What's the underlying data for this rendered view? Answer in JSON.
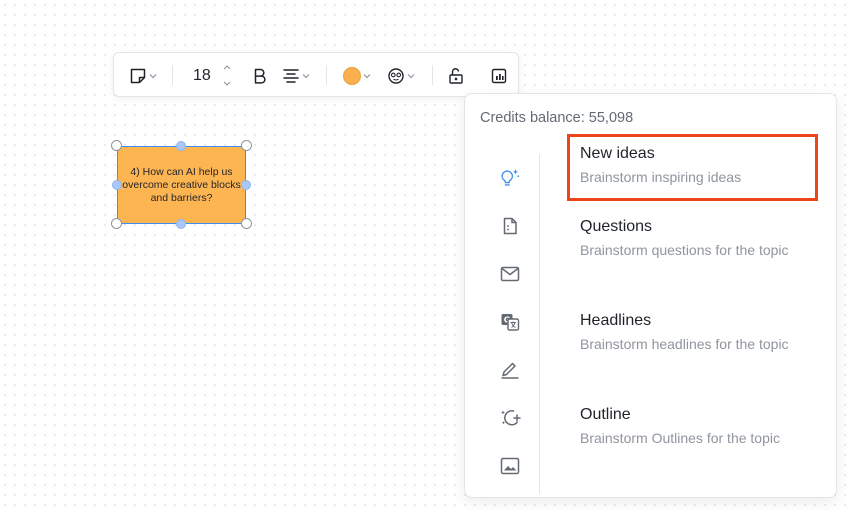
{
  "toolbar": {
    "font_size": "18",
    "fill_color": "#fbb04f",
    "icons": [
      "sticky-note-icon",
      "chevron-up-icon",
      "chevron-down-icon",
      "bold-icon",
      "align-center-icon",
      "color-swatch-icon",
      "face-icon",
      "lock-icon",
      "chart-icon"
    ]
  },
  "sticky": {
    "lines": [
      "4) How can AI help us",
      "overcome creative blocks",
      "and barriers?"
    ],
    "color": "#fdb552"
  },
  "ai_panel": {
    "credits": "Credits balance: 55,098",
    "rail_icons": [
      "lightbulb-sparkle-icon",
      "document-icon",
      "mail-icon",
      "translate-icon",
      "pencil-icon",
      "magic-wand-icon",
      "image-icon"
    ],
    "options": [
      {
        "title": "New ideas",
        "desc": "Brainstorm inspiring ideas"
      },
      {
        "title": "Questions",
        "desc": "Brainstorm questions for the topic"
      },
      {
        "title": "Headlines",
        "desc": "Brainstorm headlines for the topic"
      },
      {
        "title": "Outline",
        "desc": "Brainstorm Outlines for the topic"
      }
    ],
    "highlight_color": "#ee4419",
    "accent_color": "#3d8ff0"
  }
}
